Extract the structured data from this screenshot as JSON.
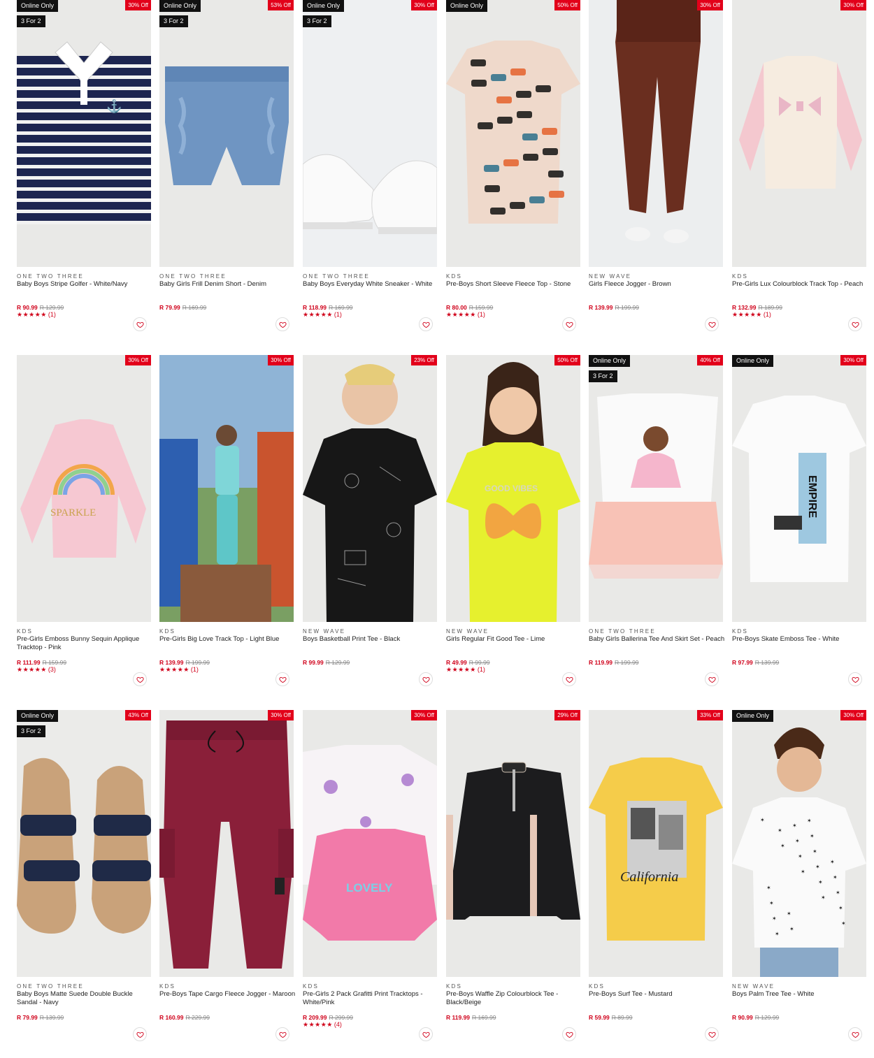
{
  "colors": {
    "accent": "#e2001a",
    "price": "#d0021b",
    "tag_bg": "#111111",
    "card_bg": "#e9e9e7"
  },
  "products": [
    {
      "brand": "ONE TWO THREE",
      "name": "Baby Boys Stripe Golfer - White/Navy",
      "price": "R 90.99",
      "was": "R 129.99",
      "off": "30% Off",
      "online": "Online Only",
      "deal": "3 For 2",
      "stars": "★★★★★",
      "reviews": "(1)",
      "art": "stripe-golfer"
    },
    {
      "brand": "ONE TWO THREE",
      "name": "Baby Girls Frill Denim Short - Denim",
      "price": "R 79.99",
      "was": "R 169.99",
      "off": "53% Off",
      "online": "Online Only",
      "deal": "3 For 2",
      "stars": "",
      "reviews": "",
      "art": "denim-short"
    },
    {
      "brand": "ONE TWO THREE",
      "name": "Baby Boys Everyday White Sneaker - White",
      "price": "R 118.99",
      "was": "R 169.99",
      "off": "30% Off",
      "online": "Online Only",
      "deal": "3 For 2",
      "stars": "★★★★★",
      "reviews": "(1)",
      "art": "sneaker"
    },
    {
      "brand": "KDS",
      "name": "Pre-Boys Short Sleeve Fleece Top - Stone",
      "price": "R 80.00",
      "was": "R 159.99",
      "off": "50% Off",
      "online": "Online Only",
      "deal": "",
      "stars": "★★★★★",
      "reviews": "(1)",
      "art": "graffiti-tee"
    },
    {
      "brand": "NEW WAVE",
      "name": "Girls Fleece Jogger - Brown",
      "price": "R 139.99",
      "was": "R 199.99",
      "off": "30% Off",
      "online": "",
      "deal": "",
      "stars": "",
      "reviews": "",
      "art": "brown-jogger"
    },
    {
      "brand": "KDS",
      "name": "Pre-Girls Lux Colourblock Track Top - Peach",
      "price": "R 132.99",
      "was": "R 189.99",
      "off": "30% Off",
      "online": "",
      "deal": "",
      "stars": "★★★★★",
      "reviews": "(1)",
      "art": "peach-top"
    },
    {
      "brand": "KDS",
      "name": "Pre-Girls Emboss Bunny Sequin Applique Tracktop - Pink",
      "price": "R 111.99",
      "was": "R 159.99",
      "off": "30% Off",
      "online": "",
      "deal": "",
      "stars": "★★★★★",
      "reviews": "(3)",
      "art": "pink-sweater"
    },
    {
      "brand": "KDS",
      "name": "Pre-Girls Big Love Track Top - Light Blue",
      "price": "R 139.99",
      "was": "R 199.99",
      "off": "30% Off",
      "online": "",
      "deal": "",
      "stars": "★★★★★",
      "reviews": "(1)",
      "art": "playground"
    },
    {
      "brand": "NEW WAVE",
      "name": "Boys Basketball Print Tee - Black",
      "price": "R 99.99",
      "was": "R 129.99",
      "off": "23% Off",
      "online": "",
      "deal": "",
      "stars": "",
      "reviews": "",
      "art": "black-tee-boy"
    },
    {
      "brand": "NEW WAVE",
      "name": "Girls Regular Fit Good Tee - Lime",
      "price": "R 49.99",
      "was": "R 99.99",
      "off": "50% Off",
      "online": "",
      "deal": "",
      "stars": "★★★★★",
      "reviews": "(1)",
      "art": "lime-tee-girl"
    },
    {
      "brand": "ONE TWO THREE",
      "name": "Baby Girls Ballerina Tee And Skirt Set - Peach",
      "price": "R 119.99",
      "was": "R 199.99",
      "off": "40% Off",
      "online": "Online Only",
      "deal": "3 For 2",
      "stars": "",
      "reviews": "",
      "art": "ballerina-set"
    },
    {
      "brand": "KDS",
      "name": "Pre-Boys Skate Emboss Tee - White",
      "price": "R 97.99",
      "was": "R 139.99",
      "off": "30% Off",
      "online": "Online Only",
      "deal": "",
      "stars": "",
      "reviews": "",
      "art": "white-tee-empire"
    },
    {
      "brand": "ONE TWO THREE",
      "name": "Baby Boys Matte Suede Double Buckle Sandal - Navy",
      "price": "R 79.99",
      "was": "R 139.99",
      "off": "43% Off",
      "online": "Online Only",
      "deal": "3 For 2",
      "stars": "",
      "reviews": "",
      "art": "sandals"
    },
    {
      "brand": "KDS",
      "name": "Pre-Boys Tape Cargo Fleece Jogger - Maroon",
      "price": "R 160.99",
      "was": "R 229.99",
      "off": "30% Off",
      "online": "",
      "deal": "",
      "stars": "",
      "reviews": "",
      "art": "maroon-jogger"
    },
    {
      "brand": "KDS",
      "name": "Pre-Girls 2 Pack Grafitti Print Tracktops - White/Pink",
      "price": "R 209.99",
      "was": "R 299.99",
      "off": "30% Off",
      "online": "",
      "deal": "",
      "stars": "★★★★★",
      "reviews": "(4)",
      "art": "two-pack"
    },
    {
      "brand": "KDS",
      "name": "Pre-Boys Waffle Zip Colourblock Tee - Black/Beige",
      "price": "R 119.99",
      "was": "R 169.99",
      "off": "29% Off",
      "online": "",
      "deal": "",
      "stars": "",
      "reviews": "",
      "art": "black-zip"
    },
    {
      "brand": "KDS",
      "name": "Pre-Boys Surf Tee - Mustard",
      "price": "R 59.99",
      "was": "R 89.99",
      "off": "33% Off",
      "online": "",
      "deal": "",
      "stars": "",
      "reviews": "",
      "art": "mustard-tee"
    },
    {
      "brand": "NEW WAVE",
      "name": "Boys Palm Tree Tee - White",
      "price": "R 90.99",
      "was": "R 129.99",
      "off": "30% Off",
      "online": "Online Only",
      "deal": "",
      "stars": "",
      "reviews": "",
      "art": "palm-tee-boy"
    }
  ]
}
